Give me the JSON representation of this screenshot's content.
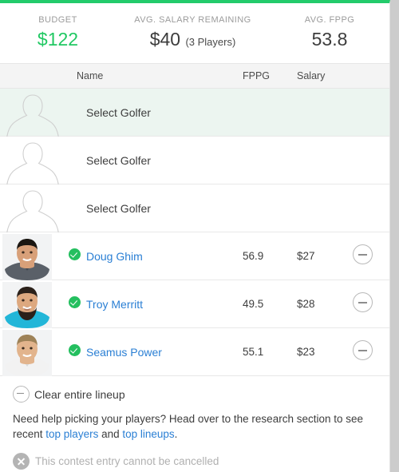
{
  "theme": {
    "accent_green": "#23cb6b",
    "link_blue": "#2a7fd4",
    "muted_gray": "#b0b0b0",
    "highlight_row": "#ecf5f0"
  },
  "summary": {
    "budget": {
      "label": "BUDGET",
      "value": "$122"
    },
    "avg_salary_remaining": {
      "label": "AVG. SALARY REMAINING",
      "value": "$40",
      "sub": "(3 Players)"
    },
    "avg_fppg": {
      "label": "AVG. FPPG",
      "value": "53.8"
    }
  },
  "table": {
    "columns": {
      "name": "Name",
      "fppg": "FPPG",
      "salary": "Salary"
    },
    "rows": [
      {
        "type": "empty",
        "name": "Select Golfer",
        "fppg": "",
        "salary": "",
        "highlight": true,
        "avatar": "placeholder-avatar-icon"
      },
      {
        "type": "empty",
        "name": "Select Golfer",
        "fppg": "",
        "salary": "",
        "highlight": false,
        "avatar": "placeholder-avatar-icon"
      },
      {
        "type": "empty",
        "name": "Select Golfer",
        "fppg": "",
        "salary": "",
        "highlight": false,
        "avatar": "placeholder-avatar-icon"
      },
      {
        "type": "filled",
        "name": "Doug Ghim",
        "fppg": "56.9",
        "salary": "$27",
        "highlight": false,
        "avatar": "player-photo-doug-ghim"
      },
      {
        "type": "filled",
        "name": "Troy Merritt",
        "fppg": "49.5",
        "salary": "$28",
        "highlight": false,
        "avatar": "player-photo-troy-merritt"
      },
      {
        "type": "filled",
        "name": "Seamus Power",
        "fppg": "55.1",
        "salary": "$23",
        "highlight": false,
        "avatar": "player-photo-seamus-power"
      }
    ]
  },
  "footer": {
    "clear_lineup_label": "Clear entire lineup",
    "clear_lineup_icon": "minus-circle-icon",
    "help": {
      "part1": "Need help picking your players? Head over to the research section to see recent ",
      "link1": "top players",
      "part2": " and ",
      "link2": "top lineups",
      "part3": "."
    },
    "cancel_notice": {
      "icon": "x-circle-icon",
      "text": "This contest entry cannot be cancelled"
    }
  }
}
